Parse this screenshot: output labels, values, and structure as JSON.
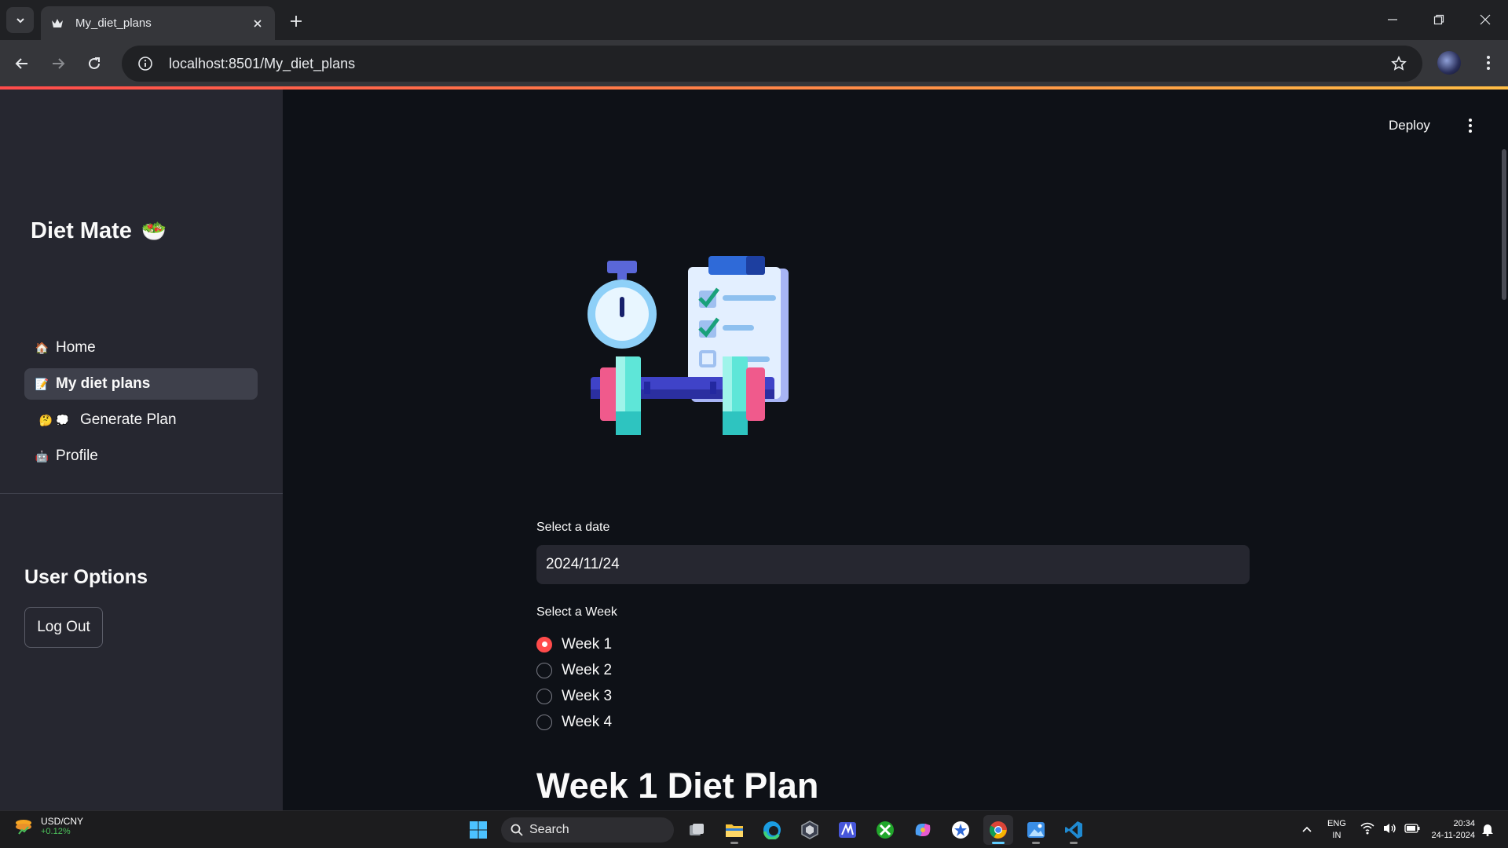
{
  "browser": {
    "tab_title": "My_diet_plans",
    "url": "localhost:8501/My_diet_plans"
  },
  "sidebar": {
    "brand": "Diet Mate",
    "brand_emoji": "🥗",
    "nav": [
      {
        "label": "Home",
        "emoji": "🏠"
      },
      {
        "label": "My diet plans",
        "emoji": "📝"
      },
      {
        "label": "Generate Plan",
        "emoji": "🤔 💭"
      },
      {
        "label": "Profile",
        "emoji": "🤖"
      }
    ],
    "user_options_title": "User Options",
    "logout_label": "Log Out"
  },
  "header": {
    "deploy_label": "Deploy"
  },
  "main": {
    "date_label": "Select a date",
    "date_value": "2024/11/24",
    "week_label": "Select a Week",
    "weeks": [
      "Week 1",
      "Week 2",
      "Week 3",
      "Week 4"
    ],
    "selected_week": "Week 1",
    "plan_heading": "Week 1 Diet Plan"
  },
  "taskbar": {
    "widget_title": "USD/CNY",
    "widget_value": "+0.12%",
    "search_label": "Search",
    "lang_top": "ENG",
    "lang_bottom": "IN",
    "time": "20:34",
    "date": "24-11-2024"
  },
  "colors": {
    "accent": "#ff4b4b",
    "app_bg": "#0e1117",
    "sidebar_bg": "#262730"
  }
}
